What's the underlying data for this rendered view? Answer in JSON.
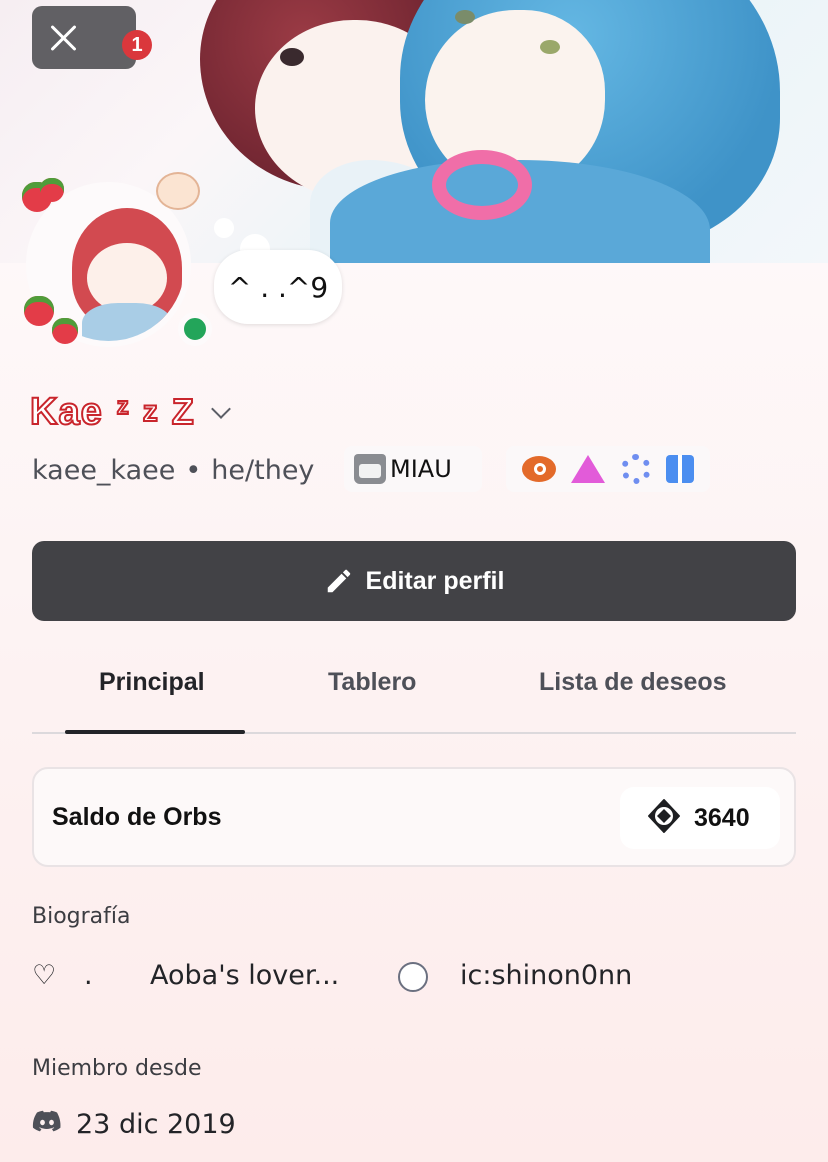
{
  "header": {
    "notification_count": "1"
  },
  "profile": {
    "status_bubble": "^ . .^9",
    "display_name": "Kae",
    "display_name_deco": [
      "z",
      "z",
      "Z"
    ],
    "username": "kaee_kaee",
    "separator": "•",
    "pronouns": "he/they",
    "tag_label": "MIAU",
    "badges": [
      "boost-badge-icon",
      "nitro-triangle-icon",
      "laurel-badge-icon",
      "gift-badge-icon"
    ],
    "colors": {
      "name_outline": "#c9252c",
      "status_online": "#23a55a",
      "edit_button_bg": "#424246",
      "notification_badge": "#da373c"
    }
  },
  "actions": {
    "edit_profile_label": "Editar perfil"
  },
  "tabs": [
    {
      "label": "Principal",
      "active": true
    },
    {
      "label": "Tablero",
      "active": false
    },
    {
      "label": "Lista de deseos",
      "active": false
    }
  ],
  "orbs": {
    "label": "Saldo de Orbs",
    "value": "3640"
  },
  "bio": {
    "title": "Biografía",
    "heart": "♡",
    "dot": ".",
    "text1": "Aoba's lover...",
    "text2": "ic:shinon0nn"
  },
  "member_since": {
    "title": "Miembro desde",
    "date": "23 dic 2019"
  }
}
